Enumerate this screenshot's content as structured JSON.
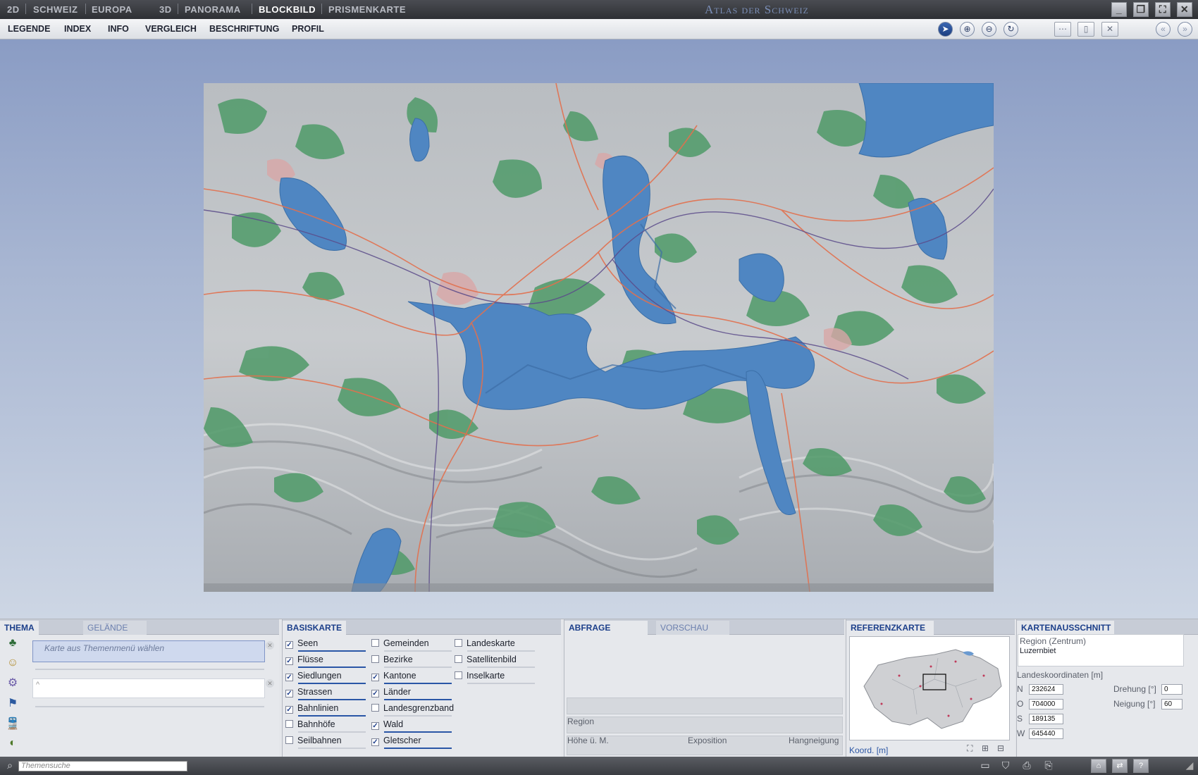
{
  "topbar": {
    "mode_2d": "2D",
    "schweiz": "SCHWEIZ",
    "europa": "EUROPA",
    "mode_3d": "3D",
    "panorama": "PANORAMA",
    "blockbild": "BLOCKBILD",
    "prismenkarte": "PRISMENKARTE",
    "title": "Atlas der Schweiz"
  },
  "menu": {
    "legende": "LEGENDE",
    "index": "INDEX",
    "info": "INFO",
    "vergleich": "VERGLEICH",
    "beschriftung": "BESCHRIFTUNG",
    "profil": "PROFIL"
  },
  "thema": {
    "tab_thema": "THEMA",
    "tab_gelaende": "GELÄNDE",
    "placeholder": "Karte aus Themenmenü wählen"
  },
  "basiskarte": {
    "title": "BASISKARTE",
    "col1": [
      {
        "label": "Seen",
        "checked": true
      },
      {
        "label": "Flüsse",
        "checked": true
      },
      {
        "label": "Siedlungen",
        "checked": true
      },
      {
        "label": "Strassen",
        "checked": true
      },
      {
        "label": "Bahnlinien",
        "checked": true
      },
      {
        "label": "Bahnhöfe",
        "checked": false
      },
      {
        "label": "Seilbahnen",
        "checked": false
      }
    ],
    "col2": [
      {
        "label": "Gemeinden",
        "checked": false
      },
      {
        "label": "Bezirke",
        "checked": false
      },
      {
        "label": "Kantone",
        "checked": true
      },
      {
        "label": "Länder",
        "checked": true
      },
      {
        "label": "Landesgrenzband",
        "checked": false
      },
      {
        "label": "Wald",
        "checked": true
      },
      {
        "label": "Gletscher",
        "checked": true
      }
    ],
    "col3": [
      {
        "label": "Landeskarte",
        "checked": false
      },
      {
        "label": "Satellitenbild",
        "checked": false
      },
      {
        "label": "Inselkarte",
        "checked": false
      }
    ]
  },
  "abfrage": {
    "tab_abfrage": "ABFRAGE",
    "tab_vorschau": "VORSCHAU",
    "region": "Region",
    "hoehe": "Höhe ü. M.",
    "exposition": "Exposition",
    "hangneigung": "Hangneigung"
  },
  "referenzkarte": {
    "title": "REFERENZKARTE",
    "koord": "Koord. [m]"
  },
  "kartenausschnitt": {
    "title": "KARTENAUSSCHNITT",
    "region_label": "Region (Zentrum)",
    "region_value": "Luzernbiet",
    "coords_label": "Landeskoordinaten [m]",
    "n_label": "N",
    "n_value": "232624",
    "o_label": "O",
    "o_value": "704000",
    "s_label": "S",
    "s_value": "189135",
    "w_label": "W",
    "w_value": "645440",
    "drehung_label": "Drehung [°]",
    "drehung_value": "0",
    "neigung_label": "Neigung [°]",
    "neigung_value": "60"
  },
  "status": {
    "search_placeholder": "Themensuche"
  },
  "colors": {
    "accent": "#1c3f8a",
    "lake": "#4f86c2",
    "forest": "#4f9a68"
  }
}
